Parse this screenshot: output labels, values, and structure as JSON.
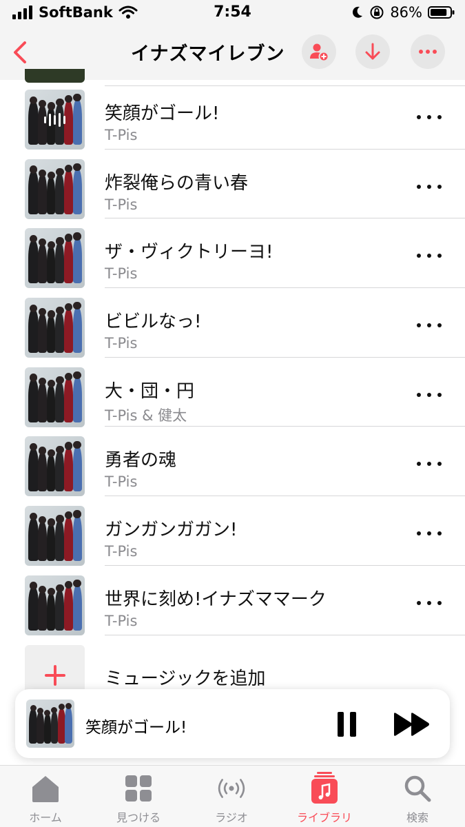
{
  "status_bar": {
    "carrier": "SoftBank",
    "time": "7:54",
    "battery": "86%",
    "battery_level": 86
  },
  "header": {
    "title": "イナズマイレブン",
    "accent_color": "#f94c57"
  },
  "tracks": [
    {
      "title": "笑顔がゴール!",
      "artist": "T-Pis",
      "now_playing": true
    },
    {
      "title": "炸裂俺らの青い春",
      "artist": "T-Pis"
    },
    {
      "title": "ザ・ヴィクトリーヨ!",
      "artist": "T-Pis"
    },
    {
      "title": "ビビルなっ!",
      "artist": "T-Pis"
    },
    {
      "title": "大・団・円",
      "artist": "T-Pis & 健太"
    },
    {
      "title": "勇者の魂",
      "artist": "T-Pis"
    },
    {
      "title": "ガンガンガガン!",
      "artist": "T-Pis"
    },
    {
      "title": "世界に刻め!イナズママーク",
      "artist": "T-Pis"
    }
  ],
  "add_music": {
    "label": "ミュージックを追加"
  },
  "mini_player": {
    "title": "笑顔がゴール!"
  },
  "tabs": [
    {
      "label": "ホーム",
      "icon": "home-icon"
    },
    {
      "label": "見つける",
      "icon": "grid-icon"
    },
    {
      "label": "ラジオ",
      "icon": "radio-icon"
    },
    {
      "label": "ライブラリ",
      "icon": "library-icon",
      "active": true
    },
    {
      "label": "検索",
      "icon": "search-icon"
    }
  ]
}
